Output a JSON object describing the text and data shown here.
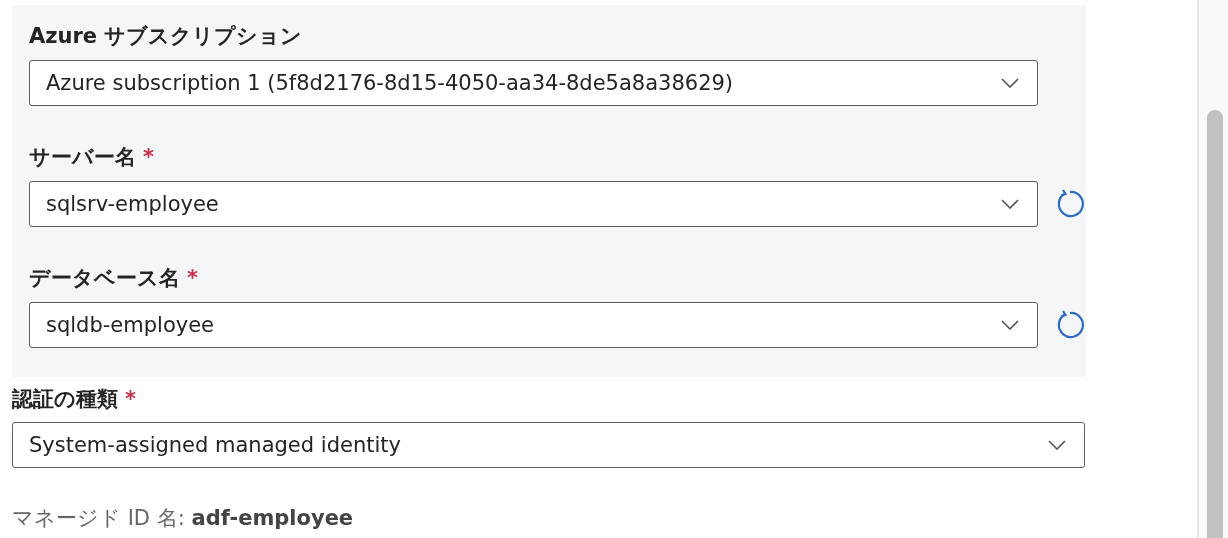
{
  "subscription_section": {
    "fields": [
      {
        "label": "Azure サブスクリプション",
        "required": false,
        "value": "Azure subscription 1 (5f8d2176-8d15-4050-aa34-8de5a8a38629)",
        "refresh": false
      },
      {
        "label": "サーバー名",
        "required": true,
        "value": "sqlsrv-employee",
        "refresh": true
      },
      {
        "label": "データベース名",
        "required": true,
        "value": "sqldb-employee",
        "refresh": true
      }
    ]
  },
  "authentication": {
    "label": "認証の種類",
    "required": true,
    "value": "System-assigned managed identity"
  },
  "managed_identity": "マネージド ID 名: **adf-employee**",
  "required_mark": "*"
}
